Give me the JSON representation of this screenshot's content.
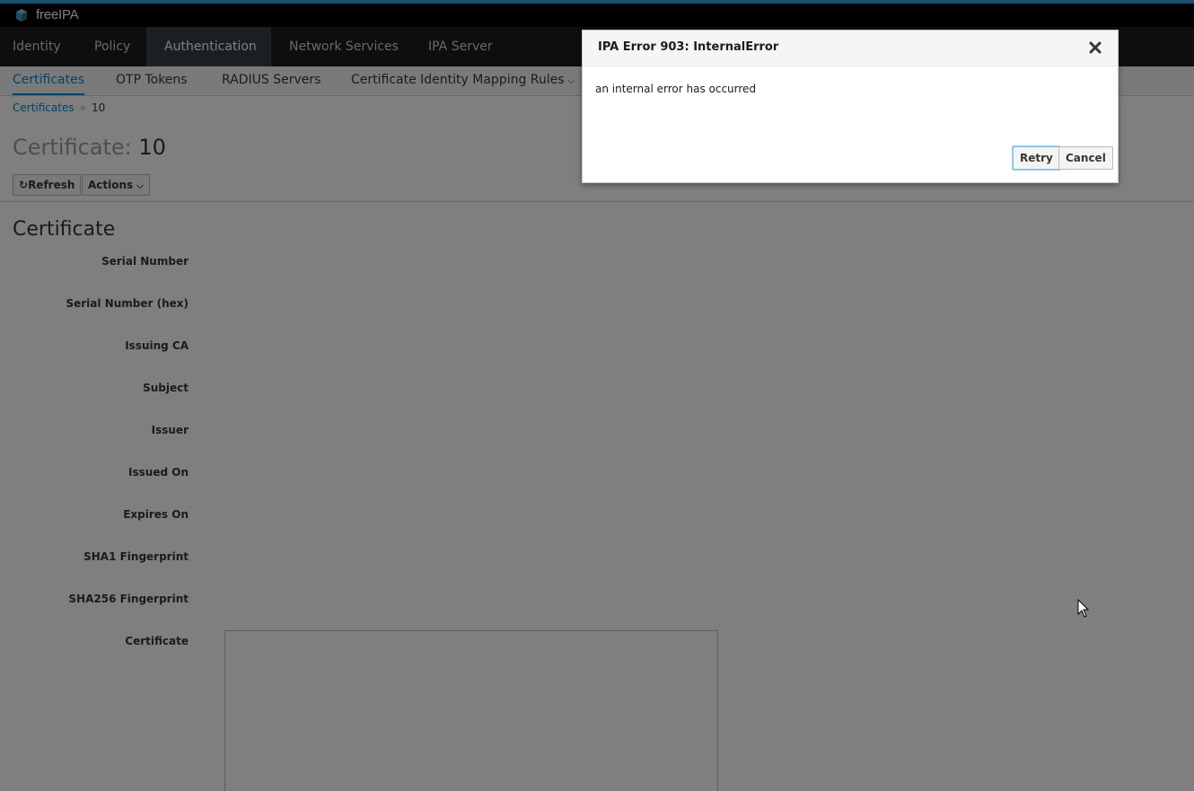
{
  "brand": {
    "name": "freeIPA"
  },
  "primary_nav": [
    {
      "label": "Identity"
    },
    {
      "label": "Policy"
    },
    {
      "label": "Authentication"
    },
    {
      "label": "Network Services"
    },
    {
      "label": "IPA Server"
    }
  ],
  "secondary_nav": [
    {
      "label": "Certificates"
    },
    {
      "label": "OTP Tokens"
    },
    {
      "label": "RADIUS Servers"
    },
    {
      "label": "Certificate Identity Mapping Rules"
    }
  ],
  "breadcrumb": {
    "parent": "Certificates",
    "separator": "»",
    "current": "10"
  },
  "page": {
    "title_prefix": "Certificate:",
    "title_value": "10",
    "refresh_label": "Refresh",
    "actions_label": "Actions"
  },
  "section": {
    "title": "Certificate",
    "fields": [
      {
        "label": "Serial Number"
      },
      {
        "label": "Serial Number (hex)"
      },
      {
        "label": "Issuing CA"
      },
      {
        "label": "Subject"
      },
      {
        "label": "Issuer"
      },
      {
        "label": "Issued On"
      },
      {
        "label": "Expires On"
      },
      {
        "label": "SHA1 Fingerprint"
      },
      {
        "label": "SHA256 Fingerprint"
      },
      {
        "label": "Certificate"
      }
    ]
  },
  "dialog": {
    "title": "IPA Error 903: InternalError",
    "message": "an internal error has occurred",
    "retry_label": "Retry",
    "cancel_label": "Cancel"
  },
  "colors": {
    "accent": "#0088ce",
    "brand_bar": "#030303",
    "nav_bg": "#1d1d1d",
    "nav_active": "#393f44"
  }
}
